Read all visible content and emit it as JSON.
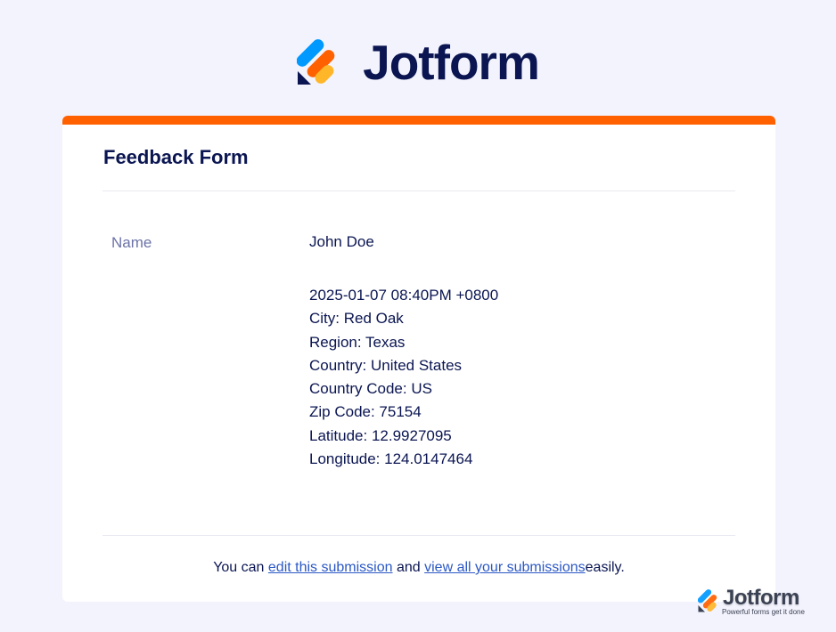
{
  "brand": {
    "name": "Jotform",
    "logo_icon": "jotform-logo-icon",
    "colors": {
      "navy": "#0a1551",
      "orange": "#ff6100",
      "blue": "#0099ff",
      "yellow": "#ffb629"
    }
  },
  "form": {
    "title": "Feedback Form",
    "accent_color": "#ff6100",
    "fields": [
      {
        "label": "Name",
        "value": "John Doe"
      }
    ],
    "meta": [
      "2025-01-07 08:40PM +0800",
      "City: Red Oak",
      "Region: Texas",
      "Country: United States",
      "Country Code: US",
      "Zip Code: 75154",
      "Latitude: 12.9927095",
      "Longitude: 124.0147464"
    ]
  },
  "footer": {
    "text_before": "You can",
    "edit_link": "edit this submission",
    "text_middle": "and",
    "view_link": "view all your submissions",
    "text_after": "easily.",
    "link_color": "#2b58c5"
  },
  "badge": {
    "name": "Jotform",
    "tagline": "Powerful forms get it done"
  }
}
